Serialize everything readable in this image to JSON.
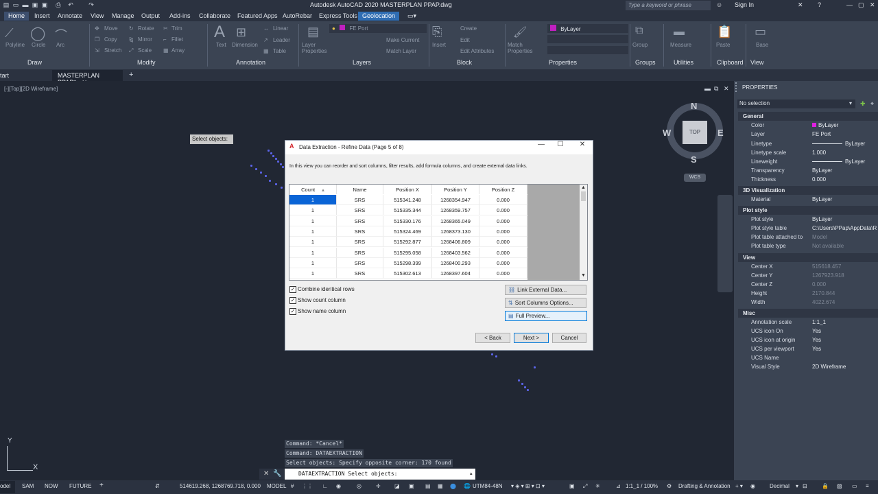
{
  "window": {
    "title": "Autodesk AutoCAD 2020    MASTERPLAN PPAP.dwg",
    "search_placeholder": "Type a keyword or phrase",
    "sign_in": "Sign In"
  },
  "menu_tabs": [
    "Home",
    "Insert",
    "Annotate",
    "View",
    "Manage",
    "Output",
    "Add-ins",
    "Collaborate",
    "Featured Apps",
    "AutoRebar",
    "Express Tools",
    "Geolocation"
  ],
  "ribbon": {
    "tools": [
      "Polyline",
      "Circle",
      "Arc",
      "Move",
      "Rotate",
      "Trim",
      "Copy",
      "Mirror",
      "Fillet",
      "Stretch",
      "Scale",
      "Array",
      "Text",
      "Dimension",
      "Linear",
      "Leader",
      "Table",
      "Layer Properties",
      "FE Port",
      "Make Current",
      "Match Layer",
      "Insert",
      "Create",
      "Edit",
      "Edit Attributes",
      "Match Properties",
      "ByLayer",
      "Group",
      "Measure",
      "Paste",
      "Base"
    ],
    "panels": [
      "Draw",
      "Modify",
      "Annotation",
      "Layers",
      "Block",
      "Properties",
      "Groups",
      "Utilities",
      "Clipboard",
      "View"
    ]
  },
  "doc_tabs": {
    "start": "tart",
    "active": "MASTERPLAN PPAP*"
  },
  "canvas": {
    "view_label": "[-][Top][2D Wireframe]",
    "tooltip": "Select objects:"
  },
  "viewcube": {
    "n": "N",
    "s": "S",
    "e": "E",
    "w": "W",
    "face": "TOP",
    "wcs": "WCS"
  },
  "properties": {
    "title": "PROPERTIES",
    "selection": "No selection",
    "sections": [
      {
        "name": "General",
        "rows": [
          [
            "Color",
            "ByLayer"
          ],
          [
            "Layer",
            "FE Port"
          ],
          [
            "Linetype",
            "ByLayer"
          ],
          [
            "Linetype scale",
            "1.000"
          ],
          [
            "Lineweight",
            "ByLayer"
          ],
          [
            "Transparency",
            "ByLayer"
          ],
          [
            "Thickness",
            "0.000"
          ]
        ]
      },
      {
        "name": "3D Visualization",
        "rows": [
          [
            "Material",
            "ByLayer"
          ]
        ]
      },
      {
        "name": "Plot style",
        "rows": [
          [
            "Plot style",
            "ByLayer"
          ],
          [
            "Plot style table",
            "C:\\Users\\PPap\\AppData\\R"
          ],
          [
            "Plot table attached to",
            "Model"
          ],
          [
            "Plot table type",
            "Not available"
          ]
        ]
      },
      {
        "name": "View",
        "rows": [
          [
            "Center X",
            "515618.457"
          ],
          [
            "Center Y",
            "1267923.918"
          ],
          [
            "Center Z",
            "0.000"
          ],
          [
            "Height",
            "2170.844"
          ],
          [
            "Width",
            "4022.674"
          ]
        ]
      },
      {
        "name": "Misc",
        "rows": [
          [
            "Annotation scale",
            "1:1_1"
          ],
          [
            "UCS icon On",
            "Yes"
          ],
          [
            "UCS icon at origin",
            "Yes"
          ],
          [
            "UCS per viewport",
            "Yes"
          ],
          [
            "UCS Name",
            ""
          ],
          [
            "Visual Style",
            "2D Wireframe"
          ]
        ]
      }
    ]
  },
  "dialog": {
    "title": "Data Extraction - Refine Data (Page 5 of 8)",
    "description": "In this view you can reorder and sort columns, filter results, add formula columns, and create external data links.",
    "columns": [
      "Count",
      "Name",
      "Position X",
      "Position Y",
      "Position Z"
    ],
    "rows": [
      [
        "1",
        "SRS",
        "515341.248",
        "1268354.947",
        "0.000"
      ],
      [
        "1",
        "SRS",
        "515335.344",
        "1268359.757",
        "0.000"
      ],
      [
        "1",
        "SRS",
        "515330.176",
        "1268365.049",
        "0.000"
      ],
      [
        "1",
        "SRS",
        "515324.469",
        "1268373.130",
        "0.000"
      ],
      [
        "1",
        "SRS",
        "515292.877",
        "1268406.809",
        "0.000"
      ],
      [
        "1",
        "SRS",
        "515295.058",
        "1268403.562",
        "0.000"
      ],
      [
        "1",
        "SRS",
        "515298.399",
        "1268400.293",
        "0.000"
      ],
      [
        "1",
        "SRS",
        "515302.613",
        "1268397.604",
        "0.000"
      ]
    ],
    "checkboxes": [
      "Combine identical rows",
      "Show count column",
      "Show name column"
    ],
    "buttons": {
      "link": "Link External Data...",
      "sort": "Sort Columns Options...",
      "preview": "Full Preview...",
      "back": "< Back",
      "next": "Next >",
      "cancel": "Cancel"
    }
  },
  "command": {
    "history": [
      "Command: *Cancel*",
      "Command: DATAEXTRACTION",
      "Select objects: Specify opposite corner: 170 found"
    ],
    "input": "DATAEXTRACTION Select objects:"
  },
  "statusbar": {
    "layouts": [
      "odel",
      "SAM",
      "NOW",
      "FUTURE"
    ],
    "coords": "514619.268, 1268769.718, 0.000",
    "model": "MODEL",
    "crs": "UTM84-48N",
    "scale": "1:1_1 / 100%",
    "workspace": "Drafting & Annotation",
    "units": "Decimal"
  }
}
